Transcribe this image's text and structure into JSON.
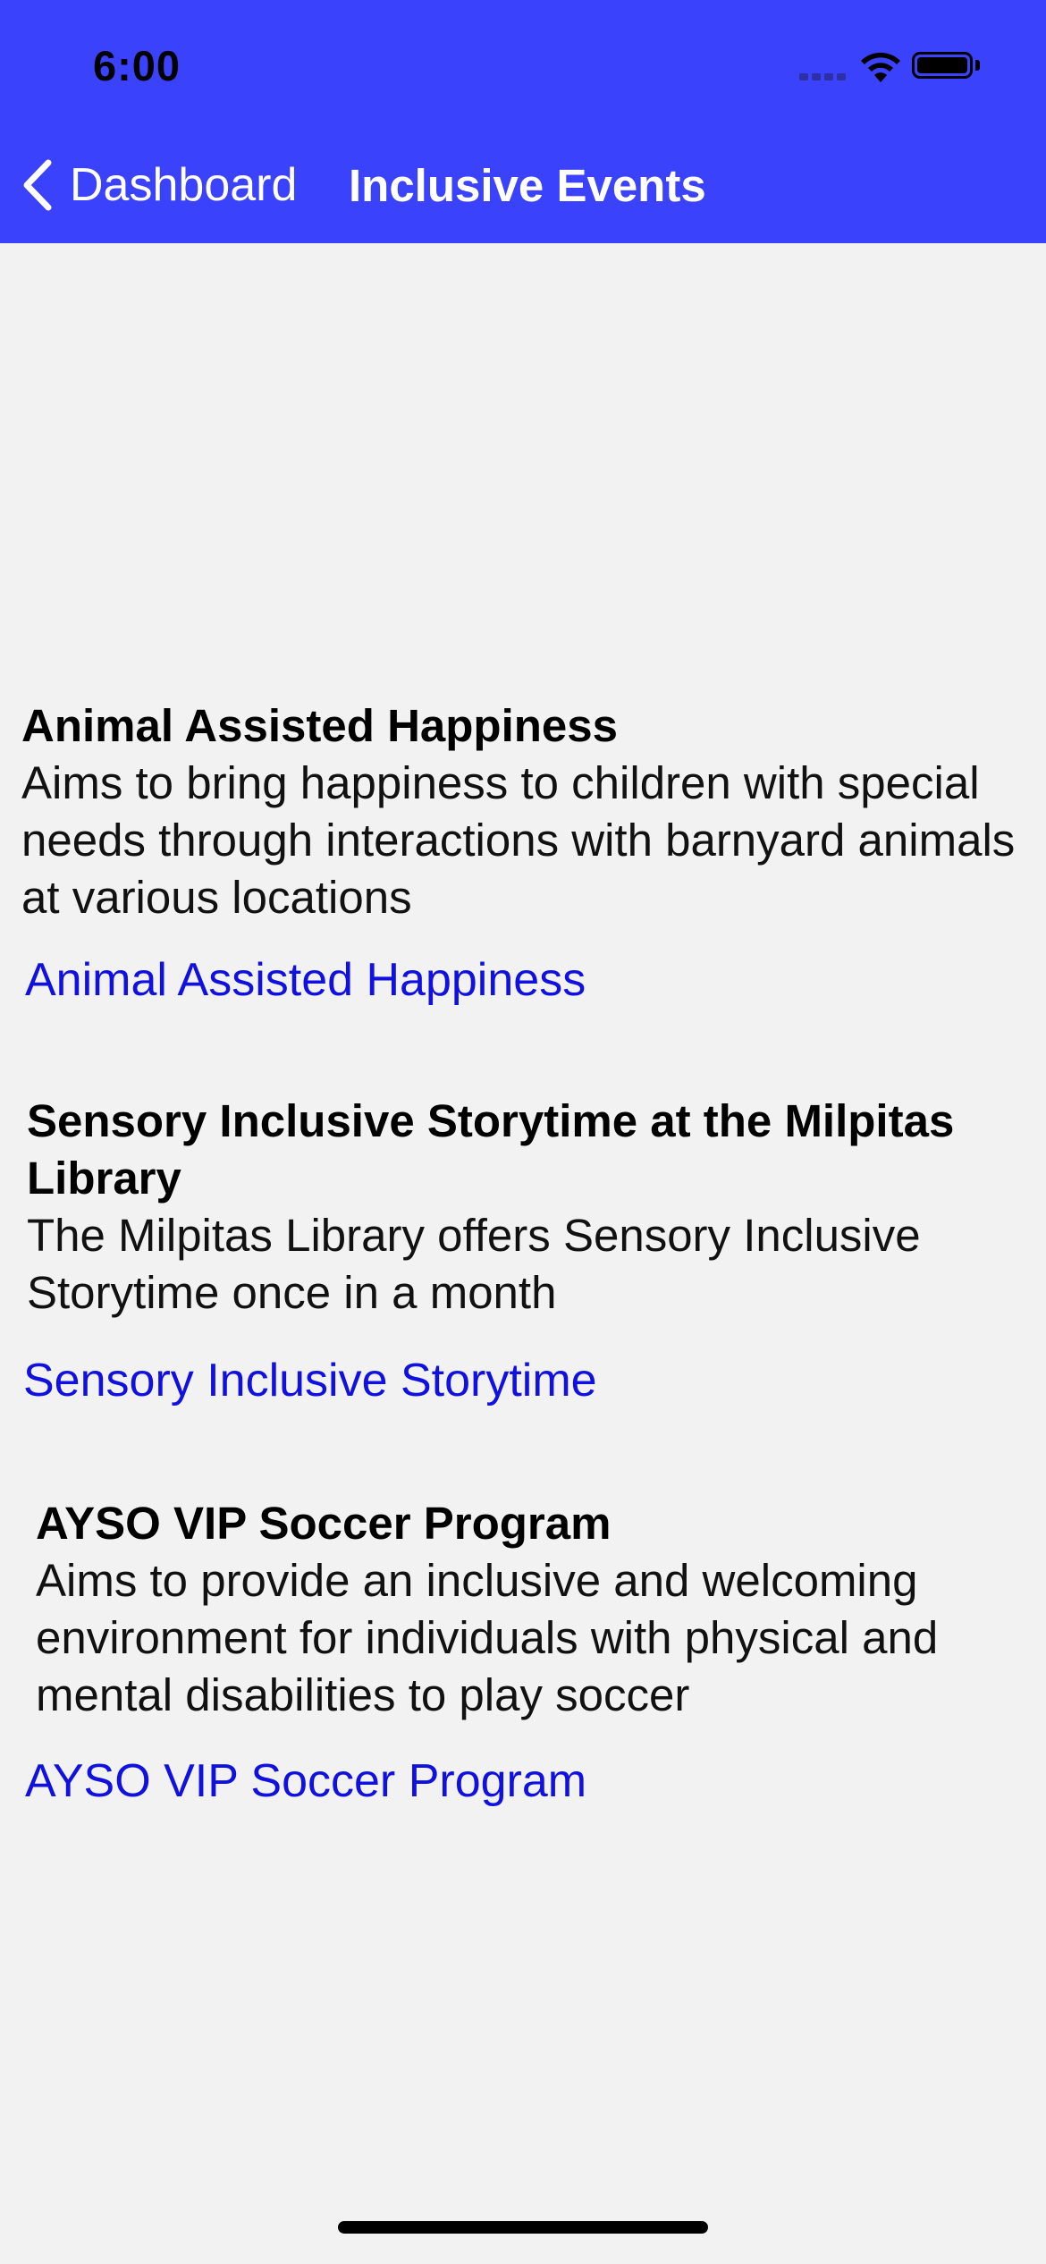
{
  "status_bar": {
    "time": "6:00"
  },
  "nav": {
    "back_label": "Dashboard",
    "title": "Inclusive Events"
  },
  "colors": {
    "header": "#3b42fb",
    "background": "#f2f2f2",
    "link": "#1010e0"
  },
  "events": [
    {
      "title": "Animal Assisted Happiness",
      "description": "Aims to bring happiness to children with special needs through interactions with barnyard animals at various locations",
      "link_text": "Animal Assisted Happiness"
    },
    {
      "title": "Sensory Inclusive Storytime at the Milpitas Library",
      "description": "The Milpitas Library offers Sensory Inclusive Storytime once in a month",
      "link_text": "Sensory Inclusive Storytime"
    },
    {
      "title": "AYSO VIP Soccer Program",
      "description": "Aims to provide an inclusive and welcoming environment for individuals with physical and mental disabilities to play soccer",
      "link_text": "AYSO VIP Soccer Program"
    }
  ]
}
